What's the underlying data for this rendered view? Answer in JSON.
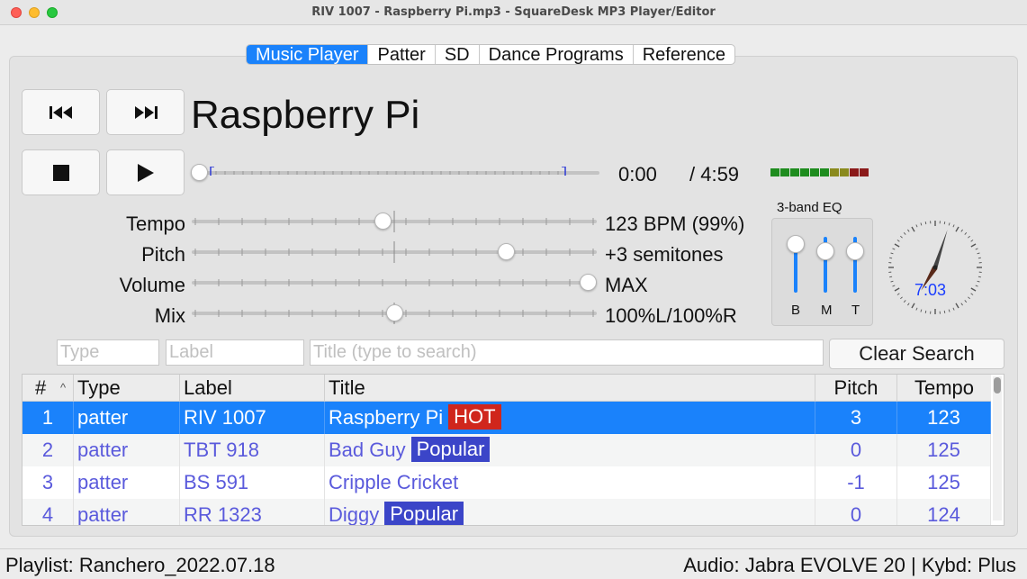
{
  "window": {
    "title": "RIV 1007 - Raspberry Pi.mp3 - SquareDesk MP3 Player/Editor"
  },
  "tabs": [
    {
      "label": "Music Player",
      "active": true
    },
    {
      "label": "Patter"
    },
    {
      "label": "SD"
    },
    {
      "label": "Dance Programs"
    },
    {
      "label": "Reference"
    }
  ],
  "player": {
    "song_title": "Raspberry Pi",
    "current_time": "0:00",
    "total_time": "/ 4:59",
    "progress": 0,
    "buttons": {
      "prev": "skip-back-icon",
      "next": "skip-forward-icon",
      "stop": "stop-icon",
      "play": "play-icon"
    }
  },
  "sliders": {
    "tempo": {
      "label": "Tempo",
      "value": "123 BPM (99%)",
      "position": 0.47
    },
    "pitch": {
      "label": "Pitch",
      "value": "+3 semitones",
      "position": 0.79
    },
    "volume": {
      "label": "Volume",
      "value": "MAX",
      "position": 1.0
    },
    "mix": {
      "label": "Mix",
      "value": "100%L/100%R",
      "position": 0.5
    }
  },
  "vu_meter": {
    "colors": [
      "#1e8c1e",
      "#1e8c1e",
      "#1e8c1e",
      "#1e8c1e",
      "#1e8c1e",
      "#1e8c1e",
      "#8a8a1e",
      "#8a8a1e",
      "#8b1a1a",
      "#8b1a1a"
    ]
  },
  "eq": {
    "title": "3-band EQ",
    "bands": [
      {
        "name": "B",
        "level": 1.0
      },
      {
        "name": "M",
        "level": 0.85
      },
      {
        "name": "T",
        "level": 0.85
      }
    ]
  },
  "clock": {
    "digital": "7:03"
  },
  "search": {
    "type_placeholder": "Type",
    "label_placeholder": "Label",
    "title_placeholder": "Title (type to search)",
    "clear_label": "Clear Search"
  },
  "table": {
    "headers": {
      "num": "#",
      "type": "Type",
      "label": "Label",
      "title": "Title",
      "pitch": "Pitch",
      "tempo": "Tempo"
    },
    "rows": [
      {
        "num": "1",
        "type": "patter",
        "label": "RIV 1007",
        "title": "Raspberry Pi",
        "badge": "HOT",
        "badge_color": "#d0261c",
        "pitch": "3",
        "tempo": "123",
        "selected": true
      },
      {
        "num": "2",
        "type": "patter",
        "label": "TBT 918",
        "title": "Bad Guy",
        "badge": "Popular",
        "badge_color": "#3b45c8",
        "pitch": "0",
        "tempo": "125"
      },
      {
        "num": "3",
        "type": "patter",
        "label": "BS 591",
        "title": "Cripple Cricket",
        "badge": "",
        "pitch": "-1",
        "tempo": "125"
      },
      {
        "num": "4",
        "type": "patter",
        "label": "RR 1323",
        "title": "Diggy",
        "badge": "Popular",
        "badge_color": "#3b45c8",
        "pitch": "0",
        "tempo": "124"
      }
    ]
  },
  "status": {
    "left": "Playlist: Ranchero_2022.07.18",
    "right": "Audio: Jabra EVOLVE 20  |  Kybd: Plus"
  }
}
